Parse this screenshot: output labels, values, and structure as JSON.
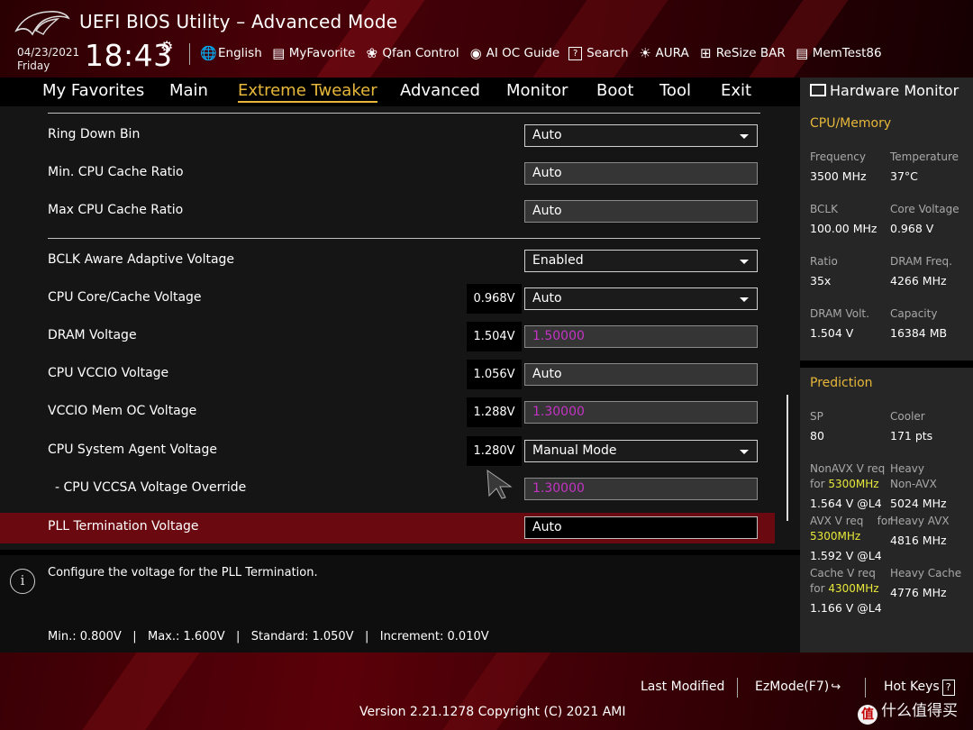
{
  "header": {
    "title": "UEFI BIOS Utility – Advanced Mode",
    "date": "04/23/2021",
    "weekday": "Friday",
    "time": "18:43",
    "tools": [
      {
        "label": "English",
        "icon": "globe-icon"
      },
      {
        "label": "MyFavorite",
        "icon": "favorite-list-icon"
      },
      {
        "label": "Qfan Control",
        "icon": "fan-icon"
      },
      {
        "label": "AI OC Guide",
        "icon": "ai-guide-icon"
      },
      {
        "label": "Search",
        "icon": "search-icon"
      },
      {
        "label": "AURA",
        "icon": "aura-light-icon"
      },
      {
        "label": "ReSize BAR",
        "icon": "resize-bar-icon"
      },
      {
        "label": "MemTest86",
        "icon": "memtest-icon"
      }
    ]
  },
  "nav": {
    "tabs": [
      "My Favorites",
      "Main",
      "Extreme Tweaker",
      "Advanced",
      "Monitor",
      "Boot",
      "Tool",
      "Exit"
    ],
    "active": "Extreme Tweaker"
  },
  "settings": [
    {
      "label": "Ring Down Bin",
      "value": "Auto",
      "readout": "",
      "kind": "dropdown"
    },
    {
      "label": "Min. CPU Cache Ratio",
      "value": "Auto",
      "readout": "",
      "kind": "text"
    },
    {
      "label": "Max CPU Cache Ratio",
      "value": "Auto",
      "readout": "",
      "kind": "text"
    },
    {
      "label": "BCLK Aware Adaptive Voltage",
      "value": "Enabled",
      "readout": "",
      "kind": "dropdown"
    },
    {
      "label": "CPU Core/Cache Voltage",
      "value": "Auto",
      "readout": "0.968V",
      "kind": "dropdown"
    },
    {
      "label": "DRAM Voltage",
      "value": "1.50000",
      "readout": "1.504V",
      "kind": "numeric"
    },
    {
      "label": "CPU VCCIO Voltage",
      "value": "Auto",
      "readout": "1.056V",
      "kind": "text"
    },
    {
      "label": "VCCIO Mem OC Voltage",
      "value": "1.30000",
      "readout": "1.288V",
      "kind": "numeric"
    },
    {
      "label": "CPU System Agent Voltage",
      "value": "Manual Mode",
      "readout": "1.280V",
      "kind": "dropdown"
    },
    {
      "label": "- CPU VCCSA Voltage Override",
      "value": "1.30000",
      "readout": "",
      "kind": "numeric"
    },
    {
      "label": "PLL Termination Voltage",
      "value": "Auto",
      "readout": "",
      "kind": "selected"
    }
  ],
  "help": {
    "text": "Configure the voltage for the PLL Termination.",
    "limits": "Min.: 0.800V   |   Max.: 1.600V   |   Standard: 1.050V   |   Increment: 0.010V"
  },
  "monitor": {
    "title": "Hardware Monitor",
    "cpu_section": "CPU/Memory",
    "frequency_label": "Frequency",
    "frequency": "3500 MHz",
    "temperature_label": "Temperature",
    "temperature": "37°C",
    "bclk_label": "BCLK",
    "bclk": "100.00 MHz",
    "core_voltage_label": "Core Voltage",
    "core_voltage": "0.968 V",
    "ratio_label": "Ratio",
    "ratio": "35x",
    "dram_freq_label": "DRAM Freq.",
    "dram_freq": "4266 MHz",
    "dram_volt_label": "DRAM Volt.",
    "dram_volt": "1.504 V",
    "capacity_label": "Capacity",
    "capacity": "16384 MB",
    "prediction_section": "Prediction",
    "sp_label": "SP",
    "sp": "80",
    "cooler_label": "Cooler",
    "cooler": "171 pts",
    "nonavx_req_label_1": "NonAVX V req",
    "nonavx_req_label_2": "for",
    "nonavx_req_freq": "5300MHz",
    "nonavx_req": "1.564 V @L4",
    "heavy_nonavx_label_1": "Heavy",
    "heavy_nonavx_label_2": "Non-AVX",
    "heavy_nonavx": "5024 MHz",
    "avx_req_label": "AVX V req    for",
    "avx_req_freq": "5300MHz",
    "avx_req": "1.592 V @L4",
    "heavy_avx_label": "Heavy AVX",
    "heavy_avx": "4816 MHz",
    "cache_req_label_1": "Cache V req",
    "cache_req_label_2": "for",
    "cache_req_freq": "4300MHz",
    "cache_req": "1.166 V @L4",
    "heavy_cache_label": "Heavy Cache",
    "heavy_cache": "4776 MHz"
  },
  "footer": {
    "last_modified": "Last Modified",
    "ezmode": "EzMode(F7)",
    "hotkeys": "Hot Keys",
    "hotkeys_key": "?",
    "version": "Version 2.21.1278 Copyright (C) 2021 AMI",
    "watermark": "什么值得买"
  },
  "colors": {
    "accent_gold": "#e7b73a",
    "highlight_yellow": "#e8e83a",
    "manual_value_magenta": "#c433c4",
    "selected_row_red": "#6a0a10"
  }
}
